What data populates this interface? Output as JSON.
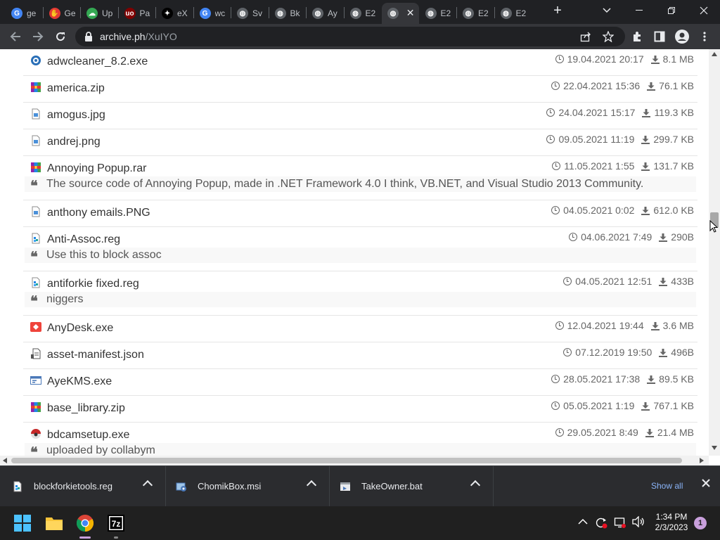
{
  "browser": {
    "tabs": [
      {
        "title": "ge",
        "favicon": "google-icon",
        "color": "#4285f4",
        "glyph": "G"
      },
      {
        "title": "Ge",
        "favicon": "red-hand-icon",
        "color": "#e53935",
        "glyph": "✋"
      },
      {
        "title": "Up",
        "favicon": "cloud-upload-icon",
        "color": "#34a853",
        "glyph": "☁"
      },
      {
        "title": "Pa",
        "favicon": "ublock-icon",
        "color": "#800000",
        "glyph": "uo"
      },
      {
        "title": "eX",
        "favicon": "puzzle-site-icon",
        "color": "#000000",
        "glyph": "✦"
      },
      {
        "title": "wc",
        "favicon": "google-icon",
        "color": "#4285f4",
        "glyph": "G"
      },
      {
        "title": "Sv",
        "favicon": "globe-icon",
        "color": "#5f6368",
        "glyph": "◍"
      },
      {
        "title": "Bk",
        "favicon": "globe-icon",
        "color": "#5f6368",
        "glyph": "◍"
      },
      {
        "title": "Ay",
        "favicon": "globe-icon",
        "color": "#5f6368",
        "glyph": "◍"
      },
      {
        "title": "E2",
        "favicon": "globe-icon",
        "color": "#5f6368",
        "glyph": "◍"
      },
      {
        "title": "",
        "favicon": "globe-icon",
        "color": "#5f6368",
        "glyph": "◍",
        "active": true
      },
      {
        "title": "E2",
        "favicon": "globe-icon",
        "color": "#5f6368",
        "glyph": "◍"
      },
      {
        "title": "E2",
        "favicon": "globe-icon",
        "color": "#5f6368",
        "glyph": "◍"
      },
      {
        "title": "E2",
        "favicon": "globe-icon",
        "color": "#5f6368",
        "glyph": "◍"
      }
    ],
    "new_tab": "+",
    "url_host": "archive.ph",
    "url_path": "/XuIYO"
  },
  "files": [
    {
      "name": "adwcleaner_8.2.exe",
      "date": "19.04.2021 20:17",
      "size": "8.1 MB",
      "icon": "adwcleaner-icon",
      "desc": ""
    },
    {
      "name": "america.zip",
      "date": "22.04.2021 15:36",
      "size": "76.1 KB",
      "icon": "archive-icon",
      "desc": ""
    },
    {
      "name": "amogus.jpg",
      "date": "24.04.2021 15:17",
      "size": "119.3 KB",
      "icon": "image-file-icon",
      "desc": ""
    },
    {
      "name": "andrej.png",
      "date": "09.05.2021 11:19",
      "size": "299.7 KB",
      "icon": "image-file-icon",
      "desc": ""
    },
    {
      "name": "Annoying Popup.rar",
      "date": "11.05.2021 1:55",
      "size": "131.7 KB",
      "icon": "archive-icon",
      "desc": "The source code of Annoying Popup, made in .NET Framework 4.0 I think, VB.NET, and Visual Studio 2013 Community."
    },
    {
      "name": "anthony emails.PNG",
      "date": "04.05.2021 0:02",
      "size": "612.0 KB",
      "icon": "image-file-icon",
      "desc": ""
    },
    {
      "name": "Anti-Assoc.reg",
      "date": "04.06.2021 7:49",
      "size": "290B",
      "icon": "registry-file-icon",
      "desc": "Use this to block assoc"
    },
    {
      "name": "antiforkie fixed.reg",
      "date": "04.05.2021 12:51",
      "size": "433B",
      "icon": "registry-file-icon",
      "desc": "niggers"
    },
    {
      "name": "AnyDesk.exe",
      "date": "12.04.2021 19:44",
      "size": "3.6 MB",
      "icon": "anydesk-icon",
      "desc": ""
    },
    {
      "name": "asset-manifest.json",
      "date": "07.12.2019 19:50",
      "size": "496B",
      "icon": "json-file-icon",
      "desc": ""
    },
    {
      "name": "AyeKMS.exe",
      "date": "28.05.2021 17:38",
      "size": "89.5 KB",
      "icon": "exe-window-icon",
      "desc": ""
    },
    {
      "name": "base_library.zip",
      "date": "05.05.2021 1:19",
      "size": "767.1 KB",
      "icon": "archive-icon",
      "desc": ""
    },
    {
      "name": "bdcamsetup.exe",
      "date": "29.05.2021 8:49",
      "size": "21.4 MB",
      "icon": "bandicam-icon",
      "desc": "uploaded by collabym"
    }
  ],
  "downloads": [
    {
      "name": "blockforkietools.reg",
      "icon": "registry-file-icon"
    },
    {
      "name": "ChomikBox.msi",
      "icon": "msi-installer-icon"
    },
    {
      "name": "TakeOwner.bat",
      "icon": "batch-file-icon"
    }
  ],
  "shelf": {
    "show_all": "Show all"
  },
  "taskbar": {
    "time": "1:34 PM",
    "date": "2/3/2023",
    "notifications": "1",
    "apps": [
      "windows-start-icon",
      "file-explorer-icon",
      "chrome-icon",
      "7zip-icon"
    ]
  },
  "colors": {
    "accent": "#8ab4f8",
    "tab_bg": "#202124",
    "toolbar_bg": "#35363a"
  }
}
